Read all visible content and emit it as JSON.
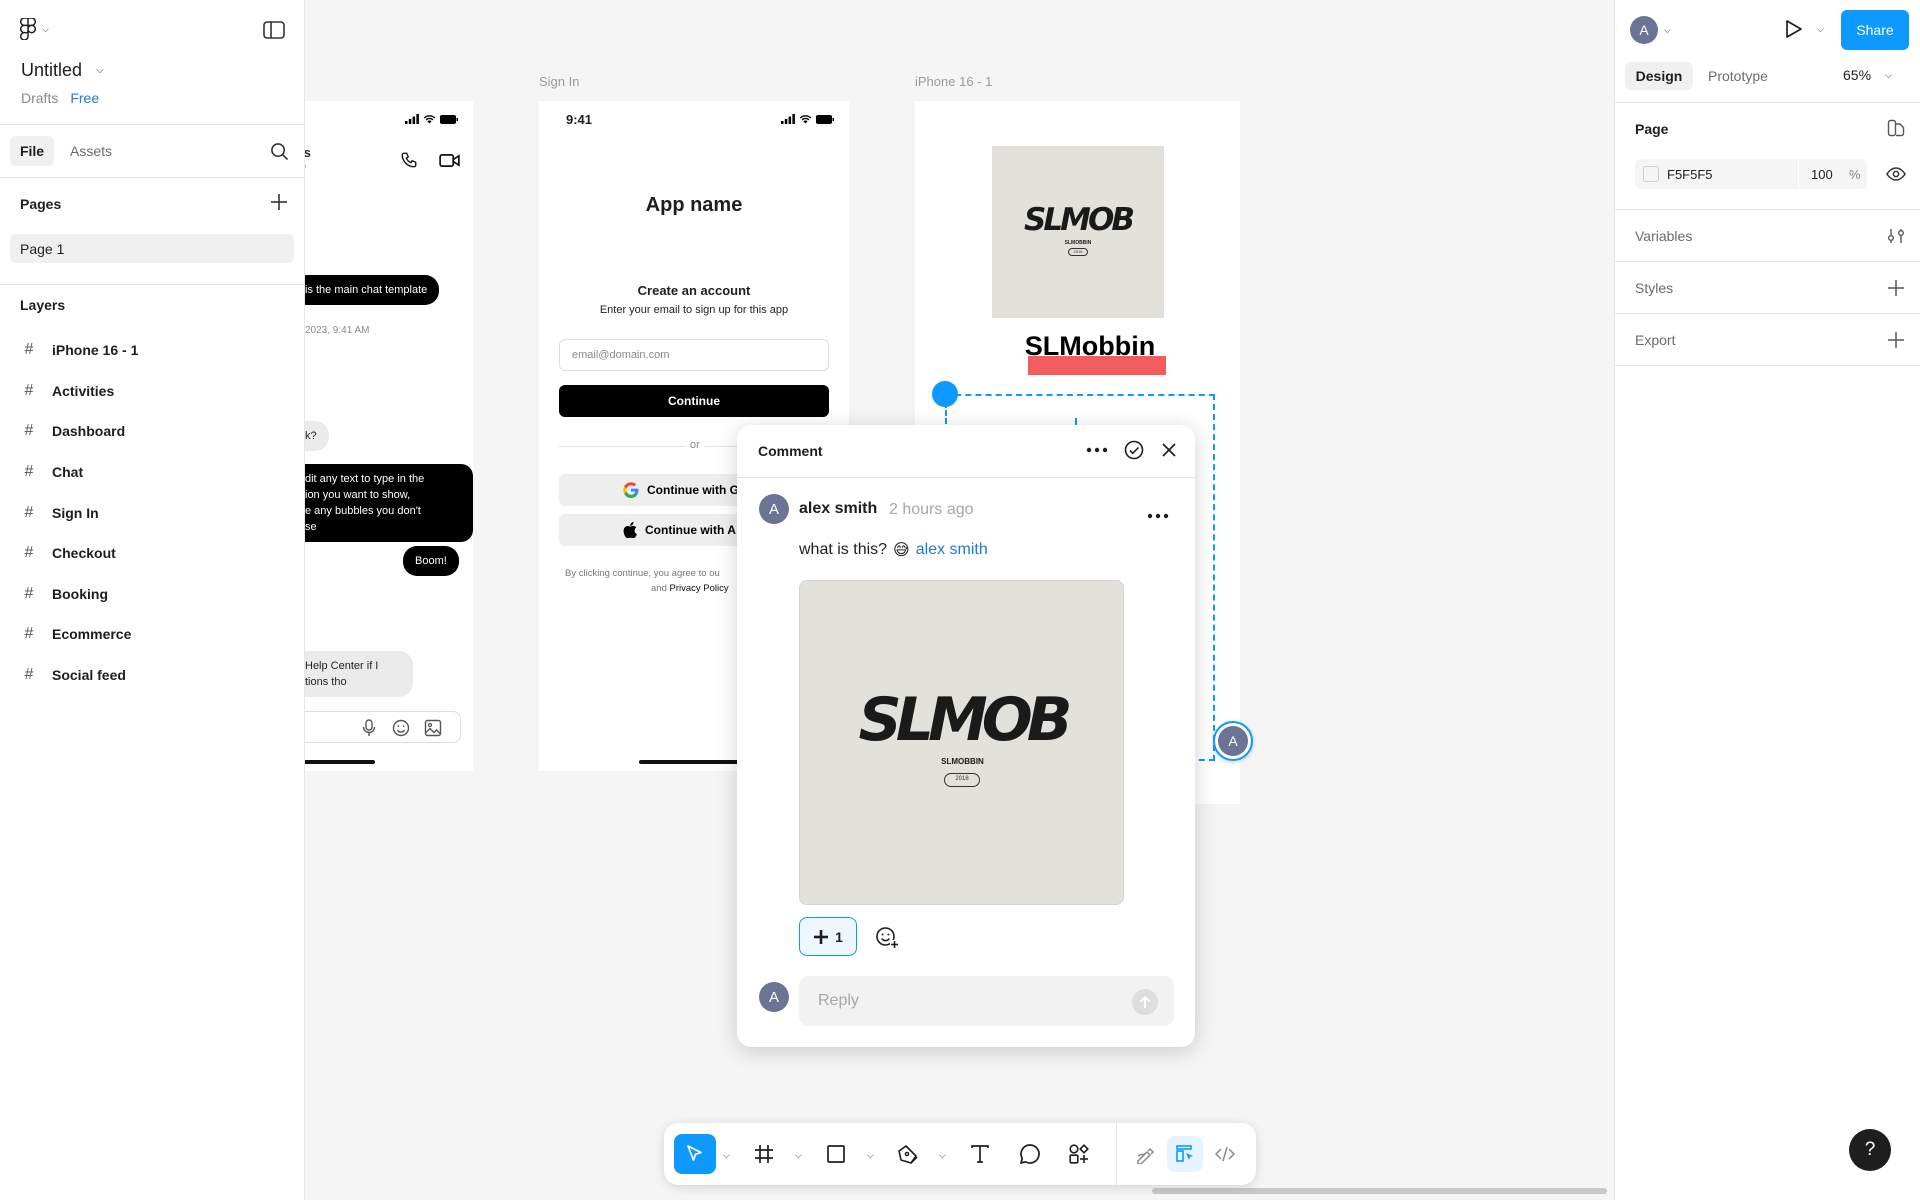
{
  "file": {
    "title": "Untitled",
    "location": "Drafts",
    "plan": "Free"
  },
  "left_tabs": {
    "file": "File",
    "assets": "Assets"
  },
  "pages": {
    "heading": "Pages",
    "items": [
      "Page 1"
    ]
  },
  "layers": {
    "heading": "Layers",
    "items": [
      "iPhone 16 - 1",
      "Activities",
      "Dashboard",
      "Chat",
      "Sign In",
      "Checkout",
      "Booking",
      "Ecommerce",
      "Social feed"
    ]
  },
  "right_panel": {
    "avatar_letter": "A",
    "share_label": "Share",
    "tabs": {
      "design": "Design",
      "prototype": "Prototype"
    },
    "zoom": "65%",
    "page_heading": "Page",
    "page_color": "F5F5F5",
    "page_opacity": "100",
    "percent_sign": "%",
    "variables": "Variables",
    "styles": "Styles",
    "export": "Export",
    "help": "?"
  },
  "canvas": {
    "chat_frame": {
      "header_partial": "ls",
      "header_sub": "p",
      "bubble_1": "is the main chat template",
      "timestamp": "2023, 9:41 AM",
      "bubble_2": "k?",
      "bubble_3_lines": [
        "dit any text to type in the",
        "ion you want to show,",
        "e any bubbles you don't",
        "se"
      ],
      "bubble_4": "Boom!",
      "bubble_5_lines": [
        "Help Center if I",
        "tions tho"
      ]
    },
    "signin_frame": {
      "label": "Sign In",
      "time": "9:41",
      "app_name": "App name",
      "create_title": "Create an account",
      "create_sub": "Enter your email to sign up for this app",
      "email_placeholder": "email@domain.com",
      "continue": "Continue",
      "or": "or",
      "google": "Continue with Go",
      "apple": "Continue with A",
      "terms_line1": "By clicking continue, you agree to ou",
      "terms_and": "and",
      "terms_privacy": "Privacy Policy"
    },
    "iphone_frame": {
      "label": "iPhone 16 - 1",
      "logo_text": "SLMOB",
      "logo_sub": "SLMOBBIN",
      "logo_year": "2018",
      "brand_name": "SLMobbin"
    },
    "comment_pin_letter": "A"
  },
  "comment": {
    "title": "Comment",
    "author": "alex smith",
    "time_ago": "2 hours ago",
    "author_letter": "A",
    "text": "what is this?",
    "emoji": "😅",
    "mention": "alex smith",
    "image_logo": "SLMOB",
    "image_sub": "SLMOBBIN",
    "image_year": "2018",
    "reaction_count": "1",
    "reply_placeholder": "Reply",
    "reply_avatar_letter": "A"
  },
  "colors": {
    "accent_blue": "#0d99ff",
    "link_blue": "#1c7bd6",
    "avatar": "#6b7494",
    "brand_highlight": "#f25c5c"
  }
}
